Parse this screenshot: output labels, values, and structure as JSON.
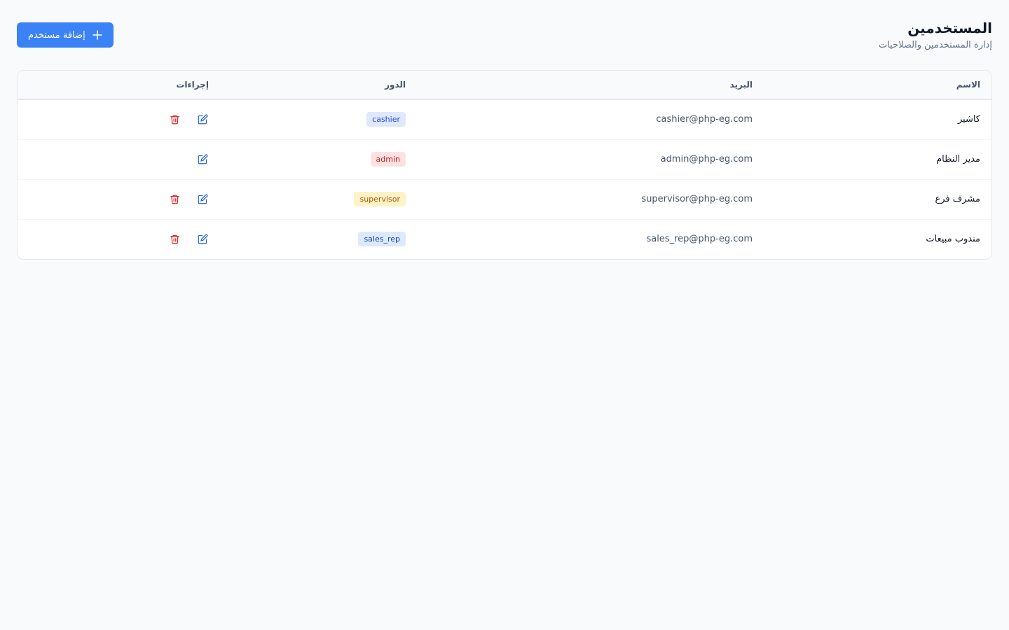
{
  "header": {
    "title": "المستخدمين",
    "subtitle": "إدارة المستخدمين والصلاحيات",
    "add_button_label": "إضافة مستخدم"
  },
  "table": {
    "columns": [
      "الاسم",
      "البريد",
      "الدور",
      "إجراءات"
    ],
    "rows": [
      {
        "name": "كاشير",
        "email": "cashier@php-eg.com",
        "role": "cashier",
        "can_delete": true
      },
      {
        "name": "مدير النظام",
        "email": "admin@php-eg.com",
        "role": "admin",
        "can_delete": false
      },
      {
        "name": "مشرف فرع",
        "email": "supervisor@php-eg.com",
        "role": "supervisor",
        "can_delete": true
      },
      {
        "name": "مندوب مبيعات",
        "email": "sales_rep@php-eg.com",
        "role": "sales_rep",
        "can_delete": true
      }
    ]
  },
  "role_colors": {
    "cashier": {
      "bg": "#e0e7ff",
      "fg": "#1d4ed8"
    },
    "admin": {
      "bg": "#fee2e2",
      "fg": "#b91c1c"
    },
    "supervisor": {
      "bg": "#fef3c7",
      "fg": "#b45309"
    },
    "sales_rep": {
      "bg": "#dbeafe",
      "fg": "#1e40af"
    }
  },
  "icons": {
    "add": "plus-icon",
    "edit": "pencil-square-icon",
    "delete": "trash-icon"
  },
  "colors": {
    "primary": "#3b82f6",
    "edit_icon": "#2563eb",
    "delete_icon": "#dc2626"
  }
}
